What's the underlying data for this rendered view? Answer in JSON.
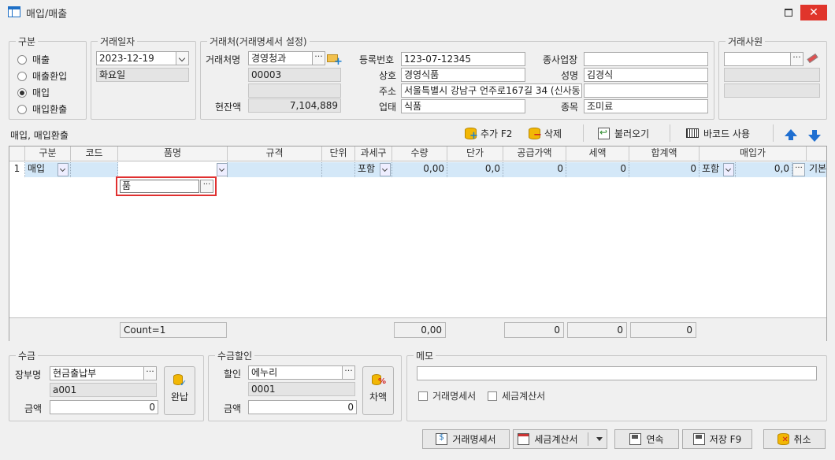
{
  "window": {
    "title": "매입/매출",
    "close_glyph": "✕"
  },
  "section_type": {
    "legend": "구분",
    "options": [
      {
        "label": "매출",
        "selected": false
      },
      {
        "label": "매출환입",
        "selected": false
      },
      {
        "label": "매입",
        "selected": true
      },
      {
        "label": "매입환출",
        "selected": false
      }
    ]
  },
  "trade_date": {
    "legend": "거래일자",
    "date": "2023-12-19",
    "weekday": "화요일"
  },
  "partner": {
    "legend": "거래처(거래명세서 설정)",
    "name_label": "거래처명",
    "name": "경영청과",
    "code": "00003",
    "blank": "",
    "balance_label": "현잔액",
    "balance": "7,104,889",
    "reg_no_label": "등록번호",
    "reg_no": "123-07-12345",
    "company_label": "상호",
    "company": "경영식품",
    "address_label": "주소",
    "address": "서울특별시 강남구 언주로167길 34 (신사동",
    "biz_type_label": "업태",
    "biz_type": "식품",
    "branch_label": "종사업장",
    "branch": "",
    "owner_label": "성명",
    "owner": "김경식",
    "item_label": "종목",
    "item": "조미료"
  },
  "employee": {
    "legend": "거래사원",
    "value": ""
  },
  "toolbar": {
    "section_label": "매입, 매입환출",
    "add_label": "추가 F2",
    "delete_label": "삭제",
    "import_label": "불러오기",
    "barcode_label": "바코드 사용"
  },
  "grid": {
    "columns": [
      "구분",
      "코드",
      "품명",
      "규격",
      "단위",
      "과세구",
      "수량",
      "단가",
      "공급가액",
      "세액",
      "합계액",
      "매입가"
    ],
    "rows": [
      {
        "no": "1",
        "type": "매입",
        "code": "",
        "name": "품",
        "spec": "",
        "unit": "",
        "tax": "포함",
        "qty": "0,00",
        "price": "0,0",
        "supply": "0",
        "vat": "0",
        "total": "0",
        "buy_tax": "포함",
        "buy_price": "0,0",
        "extra": "기본"
      }
    ],
    "footer": {
      "count": "Count=1",
      "qty_sum": "0,00",
      "supply_sum": "0",
      "vat_sum": "0",
      "total_sum": "0"
    }
  },
  "receipt": {
    "legend": "수금",
    "account_label": "장부명",
    "account": "현금출납부",
    "account_code": "a001",
    "amount_label": "금액",
    "amount": "0",
    "complete_label": "완납"
  },
  "discount": {
    "legend": "수금할인",
    "kind_label": "할인",
    "kind": "에누리",
    "kind_code": "0001",
    "amount_label": "금액",
    "amount": "0",
    "diff_label": "차액"
  },
  "memo": {
    "legend": "메모",
    "text": "",
    "chk_statement": "거래명세서",
    "chk_tax_invoice": "세금계산서"
  },
  "buttons": {
    "statement": "거래명세서",
    "tax_invoice": "세금계산서",
    "continue": "연속",
    "save": "저장 F9",
    "cancel": "취소"
  },
  "colors": {
    "accent": "#1f6fd1",
    "selected_row": "#d4e8f8",
    "edit_border": "#e03030",
    "close_red": "#e0352b"
  }
}
